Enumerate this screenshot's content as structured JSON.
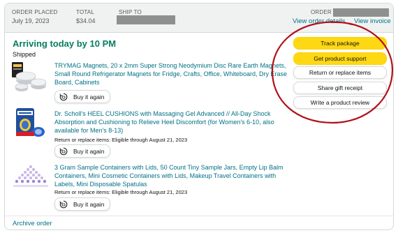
{
  "header": {
    "order_placed_label": "ORDER PLACED",
    "order_placed_value": "July 19, 2023",
    "total_label": "TOTAL",
    "total_value": "$34.04",
    "ship_to_label": "SHIP TO",
    "order_number_label": "ORDER #",
    "view_order_details": "View order details",
    "view_invoice": "View invoice"
  },
  "shipment": {
    "status": "Arriving today by 10 PM",
    "substatus": "Shipped"
  },
  "items": [
    {
      "title_line1": "TRYMAG Magnets, 20 x 2mm Super Strong Neodymium Disc Rare Earth Magnets,",
      "title_line2": "Small Round Refrigerator Magnets for Fridge, Crafts, Office, Whiteboard, Dry Erase",
      "title_line3": "Board, Cabinets",
      "note": "",
      "buy_again": "Buy it again"
    },
    {
      "title_line1": "Dr. Scholl's HEEL CUSHIONS with Massaging Gel Advanced // All-Day Shock",
      "title_line2": "Absorption and Cushioning to Relieve Heel Discomfort (for Women's 6-10, also",
      "title_line3": "available for Men's 8-13)",
      "note": "Return or replace items: Eligible through August 21, 2023",
      "buy_again": "Buy it again"
    },
    {
      "title_line1": "3 Gram Sample Containers with Lids, 50 Count Tiny Sample Jars, Empty Lip Balm",
      "title_line2": "Containers, Mini Cosmetic Containers with Lids, Makeup Travel Containers with",
      "title_line3": "Labels, Mini Disposable Spatulas",
      "note": "Return or replace items: Eligible through August 21, 2023",
      "buy_again": "Buy it again"
    }
  ],
  "actions": {
    "track_package": "Track package",
    "get_product_support": "Get product support",
    "return_or_replace": "Return or replace items",
    "share_gift_receipt": "Share gift receipt",
    "write_review": "Write a product review"
  },
  "footer": {
    "archive_order": "Archive order"
  },
  "colors": {
    "status_green": "#067d62",
    "link_teal": "#007185",
    "primary_button": "#ffd814",
    "header_bg": "#f0f2f2",
    "annotation_red": "#b0121a"
  },
  "icons": {
    "buy_again": "repeat-cart-icon"
  }
}
